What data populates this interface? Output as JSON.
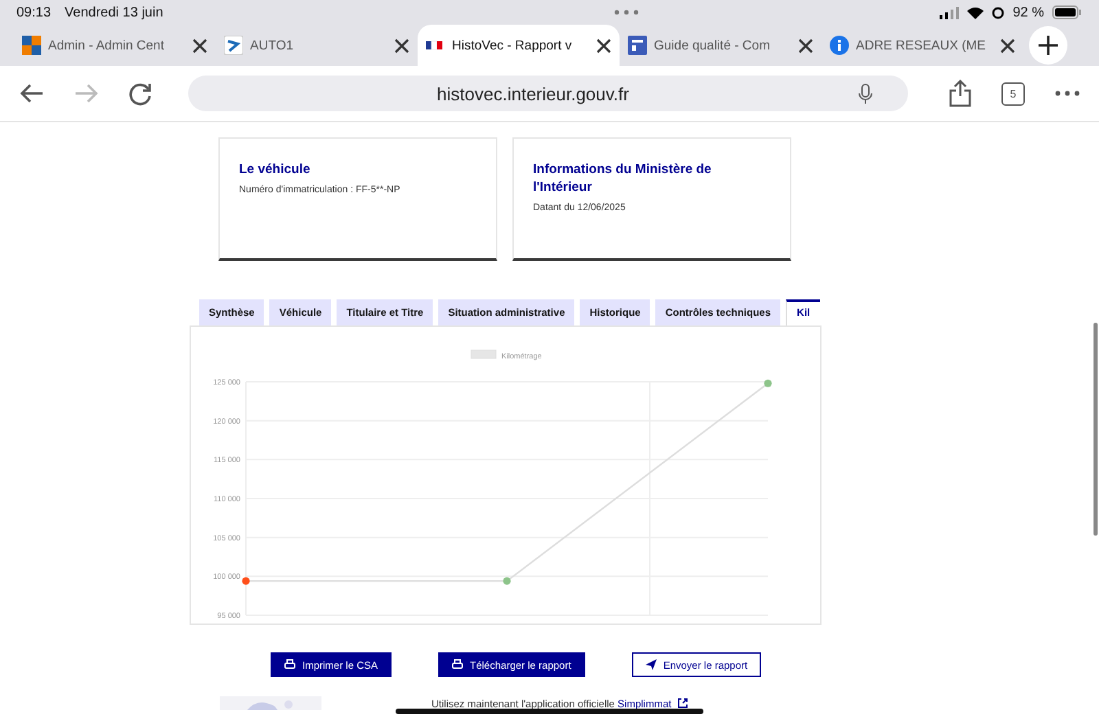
{
  "status_bar": {
    "time": "09:13",
    "date": "Vendredi 13 juin",
    "battery": "92 %"
  },
  "browser_tabs": [
    {
      "title": "Admin - Admin Cent",
      "selected": false
    },
    {
      "title": "AUTO1",
      "selected": false
    },
    {
      "title": "HistoVec - Rapport v",
      "selected": true
    },
    {
      "title": "Guide qualité - Com",
      "selected": false
    },
    {
      "title": "ADRE RESEAUX (ME",
      "selected": false
    }
  ],
  "address_bar": {
    "url": "histovec.interieur.gouv.fr",
    "tab_count": "5"
  },
  "cards": [
    {
      "title": "Le véhicule",
      "text": "Numéro d'immatriculation : FF-5**-NP"
    },
    {
      "title": "Informations du Ministère de l'Intérieur",
      "text": "Datant du 12/06/2025"
    }
  ],
  "tabs": [
    {
      "label": "Synthèse",
      "selected": false
    },
    {
      "label": "Véhicule",
      "selected": false
    },
    {
      "label": "Titulaire et Titre",
      "selected": false
    },
    {
      "label": "Situation administrative",
      "selected": false
    },
    {
      "label": "Historique",
      "selected": false
    },
    {
      "label": "Contrôles techniques",
      "selected": false
    },
    {
      "label": "Kil",
      "selected": true
    }
  ],
  "chart_data": {
    "type": "line",
    "grid": true,
    "series": [
      {
        "name": "Kilométrage",
        "color": "#dddddd",
        "marker": "circle",
        "values": [
          99400,
          99400,
          124800
        ]
      }
    ],
    "ylim": [
      95000,
      125000
    ],
    "yticks": [
      {
        "value": 125000,
        "label": "125 000"
      },
      {
        "value": 120000,
        "label": "120 000"
      },
      {
        "value": 115000,
        "label": "115 000"
      },
      {
        "value": 110000,
        "label": "110 000"
      },
      {
        "value": 105000,
        "label": "105 000"
      },
      {
        "value": 100000,
        "label": "100 000"
      },
      {
        "value": 95000,
        "label": "95 000"
      }
    ]
  },
  "buttons": [
    {
      "label": "Imprimer le CSA",
      "kind": "primary"
    },
    {
      "label": "Télécharger le rapport",
      "kind": "primary"
    },
    {
      "label": "Envoyer le rapport",
      "kind": "secondary"
    }
  ],
  "footer": {
    "text": "Utilisez maintenant l'application officielle",
    "link": "Simplimmat"
  }
}
